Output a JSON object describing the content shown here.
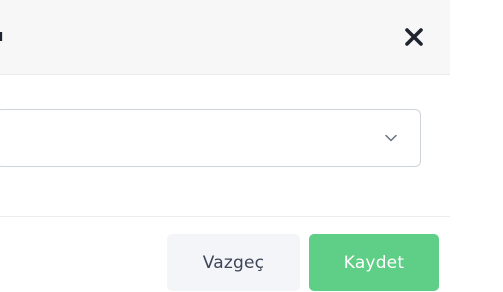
{
  "modal": {
    "title": "ı",
    "close_icon": "close-x-icon",
    "select": {
      "value": "",
      "chevron_icon": "chevron-down-icon"
    },
    "buttons": {
      "cancel_label": "Vazgeç",
      "save_label": "Kaydet"
    }
  },
  "colors": {
    "header_bg": "#f7f7f8",
    "cancel_bg": "#f3f5f8",
    "save_bg": "#5fce86",
    "close_icon": "#1f2430"
  }
}
